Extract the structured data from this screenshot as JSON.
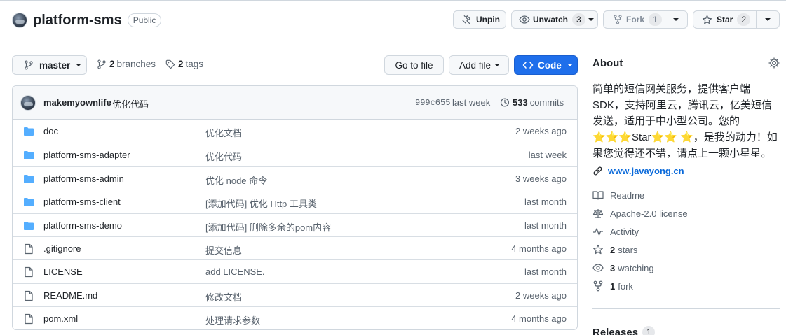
{
  "repo": {
    "name": "platform-sms",
    "visibility": "Public",
    "avatar_icon": "owner-avatar"
  },
  "header_actions": {
    "unpin_label": "Unpin",
    "unwatch_label": "Unwatch",
    "watch_count": "3",
    "fork_label": "Fork",
    "fork_count": "1",
    "star_label": "Star",
    "star_count": "2"
  },
  "toolbar": {
    "branch": "master",
    "branches_count": "2",
    "branches_label": "branches",
    "tags_count": "2",
    "tags_label": "tags",
    "go_to_file": "Go to file",
    "add_file": "Add file",
    "code": "Code",
    "code_color": "#1f6feb"
  },
  "latest_commit": {
    "user": "makemyownlife",
    "message": "优化代码",
    "hash": "999c655",
    "time": "last week",
    "commits_count": "533",
    "commits_label": "commits"
  },
  "files": [
    {
      "type": "folder",
      "name": "doc",
      "message": "优化文档",
      "time": "2 weeks ago"
    },
    {
      "type": "folder",
      "name": "platform-sms-adapter",
      "message": "优化代码",
      "time": "last week"
    },
    {
      "type": "folder",
      "name": "platform-sms-admin",
      "message": "优化 node 命令",
      "time": "3 weeks ago"
    },
    {
      "type": "folder",
      "name": "platform-sms-client",
      "message": "[添加代码] 优化 Http 工具类",
      "time": "last month"
    },
    {
      "type": "folder",
      "name": "platform-sms-demo",
      "message": "[添加代码] 删除多余的pom内容",
      "time": "last month"
    },
    {
      "type": "file",
      "name": ".gitignore",
      "message": "提交信息",
      "time": "4 months ago"
    },
    {
      "type": "file",
      "name": "LICENSE",
      "message": "add LICENSE.",
      "time": "last month"
    },
    {
      "type": "file",
      "name": "README.md",
      "message": "修改文档",
      "time": "2 weeks ago"
    },
    {
      "type": "file",
      "name": "pom.xml",
      "message": "处理请求参数",
      "time": "4 months ago"
    }
  ],
  "about": {
    "title": "About",
    "description": "简单的短信网关服务，提供客户端 SDK，支持阿里云，腾讯云，亿美短信发送，适用于中小型公司。您的 ⭐⭐⭐Star⭐⭐ ⭐，是我的动力！如果您觉得还不错，请点上一颗小星星。",
    "website": "www.javayong.cn",
    "readme": "Readme",
    "license": "Apache-2.0 license",
    "activity": "Activity",
    "stars_count": "2",
    "stars_label": "stars",
    "watching_count": "3",
    "watching_label": "watching",
    "fork_count": "1",
    "fork_label": "fork"
  },
  "releases": {
    "title": "Releases",
    "count": "1"
  }
}
